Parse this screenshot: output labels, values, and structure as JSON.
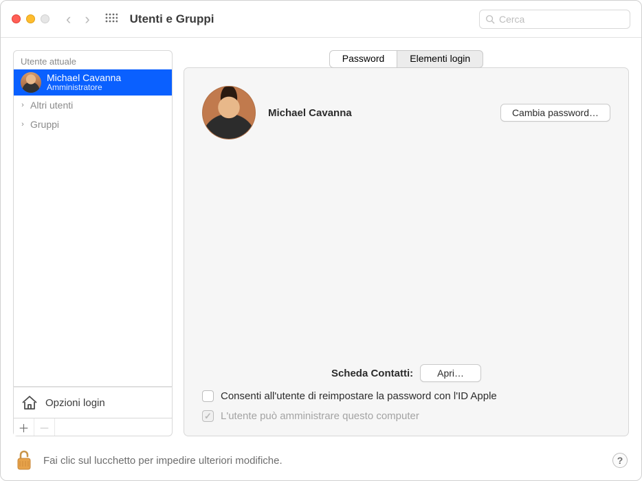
{
  "window": {
    "title": "Utenti e Gruppi"
  },
  "search": {
    "placeholder": "Cerca"
  },
  "sidebar": {
    "current_user_section": "Utente attuale",
    "current_user": {
      "name": "Michael Cavanna",
      "role": "Amministratore"
    },
    "other_users_label": "Altri utenti",
    "groups_label": "Gruppi",
    "login_options_label": "Opzioni login"
  },
  "tabs": {
    "password": "Password",
    "login_items": "Elementi login"
  },
  "panel": {
    "full_name": "Michael Cavanna",
    "change_password_btn": "Cambia password…",
    "contacts_label": "Scheda Contatti:",
    "open_btn": "Apri…",
    "reset_with_appleid": "Consenti all'utente di reimpostare la password con l'ID Apple",
    "can_administer": "L'utente può amministrare questo computer"
  },
  "footer": {
    "lock_text": "Fai clic sul lucchetto per impedire ulteriori modifiche.",
    "help": "?"
  }
}
